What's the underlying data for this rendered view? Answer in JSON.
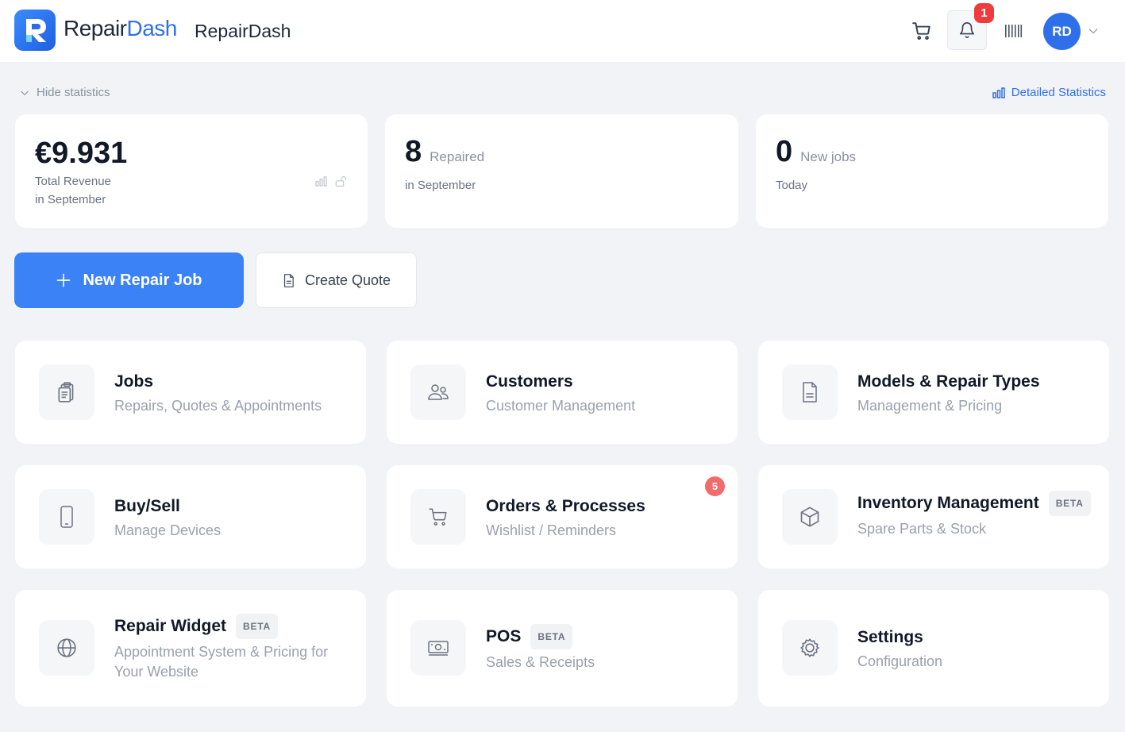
{
  "header": {
    "brand_part1": "Repair",
    "brand_part2": "Dash",
    "shop_name": "RepairDash",
    "notification_count": "1",
    "avatar_initials": "RD"
  },
  "stats_bar": {
    "hide_label": "Hide statistics",
    "detailed_label": "Detailed Statistics"
  },
  "stats": {
    "revenue": {
      "value": "€9.931",
      "label": "Total Revenue",
      "period": "in September"
    },
    "repaired": {
      "value": "8",
      "label": "Repaired",
      "period": "in September"
    },
    "new_jobs": {
      "value": "0",
      "label": "New jobs",
      "period": "Today"
    }
  },
  "actions": {
    "new_repair_job": "New Repair Job",
    "create_quote": "Create Quote"
  },
  "tiles": {
    "jobs": {
      "title": "Jobs",
      "subtitle": "Repairs, Quotes & Appointments",
      "icon": "clipboard-icon"
    },
    "customers": {
      "title": "Customers",
      "subtitle": "Customer Management",
      "icon": "users-icon"
    },
    "models": {
      "title": "Models & Repair Types",
      "subtitle": "Management & Pricing",
      "icon": "document-icon"
    },
    "buysell": {
      "title": "Buy/Sell",
      "subtitle": "Manage Devices",
      "icon": "phone-icon"
    },
    "orders": {
      "title": "Orders & Processes",
      "subtitle": "Wishlist / Reminders",
      "icon": "cart-icon",
      "badge": "5"
    },
    "inventory": {
      "title": "Inventory Management",
      "subtitle": "Spare Parts & Stock",
      "icon": "box-icon",
      "tag": "BETA"
    },
    "widget": {
      "title": "Repair Widget",
      "subtitle": "Appointment System & Pricing for Your Website",
      "icon": "globe-icon",
      "tag": "BETA"
    },
    "pos": {
      "title": "POS",
      "subtitle": "Sales & Receipts",
      "icon": "cash-icon",
      "tag": "BETA"
    },
    "settings": {
      "title": "Settings",
      "subtitle": "Configuration",
      "icon": "gear-icon"
    }
  },
  "colors": {
    "accent": "#3b82f6",
    "brand_blue": "#2f6fea",
    "badge_red": "#ef3b3b",
    "background": "#f2f3f6"
  }
}
